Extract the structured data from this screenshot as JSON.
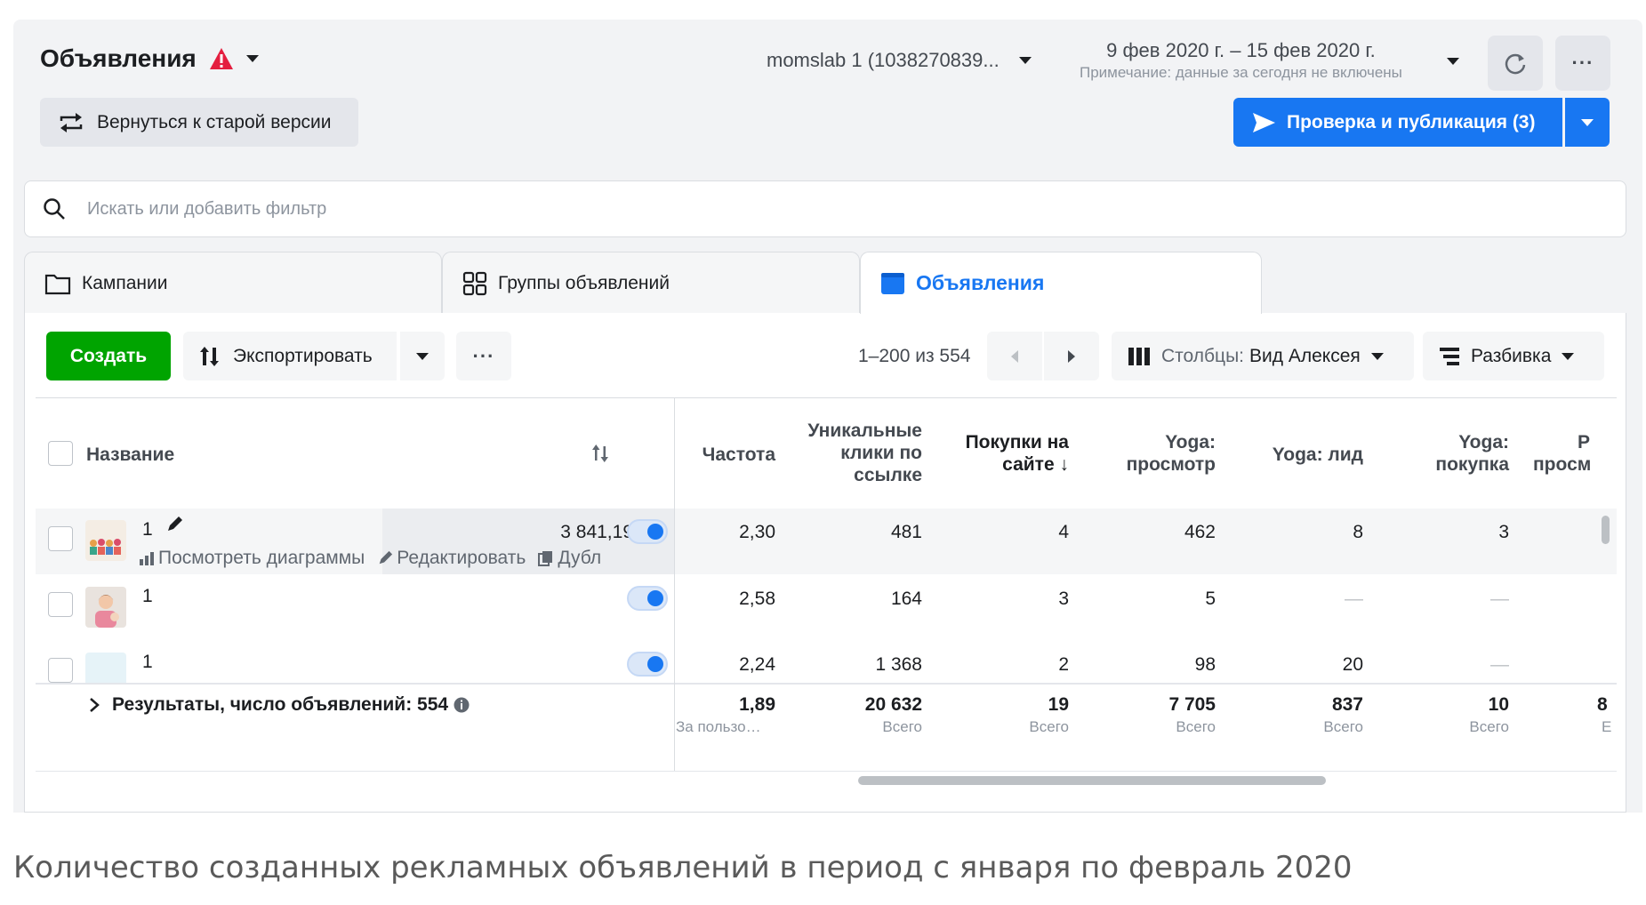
{
  "header": {
    "title": "Объявления",
    "account": "momslab 1 (1038270839...",
    "date_range": "9 фев 2020 г. – 15 фев 2020 г.",
    "date_note": "Примечание: данные за сегодня не включены",
    "old_version_label": "Вернуться к старой версии",
    "publish_label": "Проверка и публикация (3)"
  },
  "search": {
    "placeholder": "Искать или добавить фильтр"
  },
  "tabs": [
    {
      "label": "Кампании",
      "icon": "folder-icon",
      "active": false
    },
    {
      "label": "Группы объявлений",
      "icon": "grid-icon",
      "active": false
    },
    {
      "label": "Объявления",
      "icon": "ad-icon",
      "active": true
    }
  ],
  "toolbar": {
    "create_label": "Создать",
    "export_label": "Экспортировать",
    "pagination": "1–200 из 554",
    "columns_prefix": "Столбцы:",
    "columns_value": "Вид Алексея",
    "breakdown_label": "Разбивка"
  },
  "table": {
    "headers": {
      "name": "Название",
      "frequency": "Частота",
      "unique_clicks_1": "Уникальные",
      "unique_clicks_2": "клики по",
      "unique_clicks_3": "ссылке",
      "purchases_1": "Покупки на",
      "purchases_2": "сайте",
      "yoga_view_1": "Yoga:",
      "yoga_view_2": "просмотр",
      "yoga_lead": "Yoga: лид",
      "yoga_purchase_1": "Yoga:",
      "yoga_purchase_2": "покупка",
      "next_col_1": "Р",
      "next_col_2": "просм"
    },
    "rows": [
      {
        "name": "1",
        "budget": "3 841,19",
        "frequency": "2,30",
        "unique_clicks": "481",
        "purchases": "4",
        "yoga_view": "462",
        "yoga_lead": "8",
        "yoga_purchase": "3"
      },
      {
        "name": "1",
        "frequency": "2,58",
        "unique_clicks": "164",
        "purchases": "3",
        "yoga_view": "5",
        "yoga_lead": "—",
        "yoga_purchase": "—"
      },
      {
        "name": "1",
        "frequency": "2,24",
        "unique_clicks": "1 368",
        "purchases": "2",
        "yoga_view": "98",
        "yoga_lead": "20",
        "yoga_purchase": "—"
      }
    ],
    "row_actions": {
      "charts": "Посмотреть диаграммы",
      "edit": "Редактировать",
      "duplicate": "Дубл"
    },
    "summary": {
      "label": "Результаты, число объявлений: 554",
      "frequency": "1,89",
      "frequency_sub": "За пользо…",
      "unique_clicks": "20 632",
      "unique_clicks_sub": "Всего",
      "purchases": "19",
      "purchases_sub": "Всего",
      "yoga_view": "7 705",
      "yoga_view_sub": "Всего",
      "yoga_lead": "837",
      "yoga_lead_sub": "Всего",
      "yoga_purchase": "10",
      "yoga_purchase_sub": "Всего",
      "next_col": "8",
      "next_col_sub": "E"
    }
  },
  "caption": "Количество созданных рекламных объявлений в период с января по февраль 2020",
  "colors": {
    "primary": "#1877f2",
    "create": "#00a400",
    "warning": "#e41e3f"
  }
}
